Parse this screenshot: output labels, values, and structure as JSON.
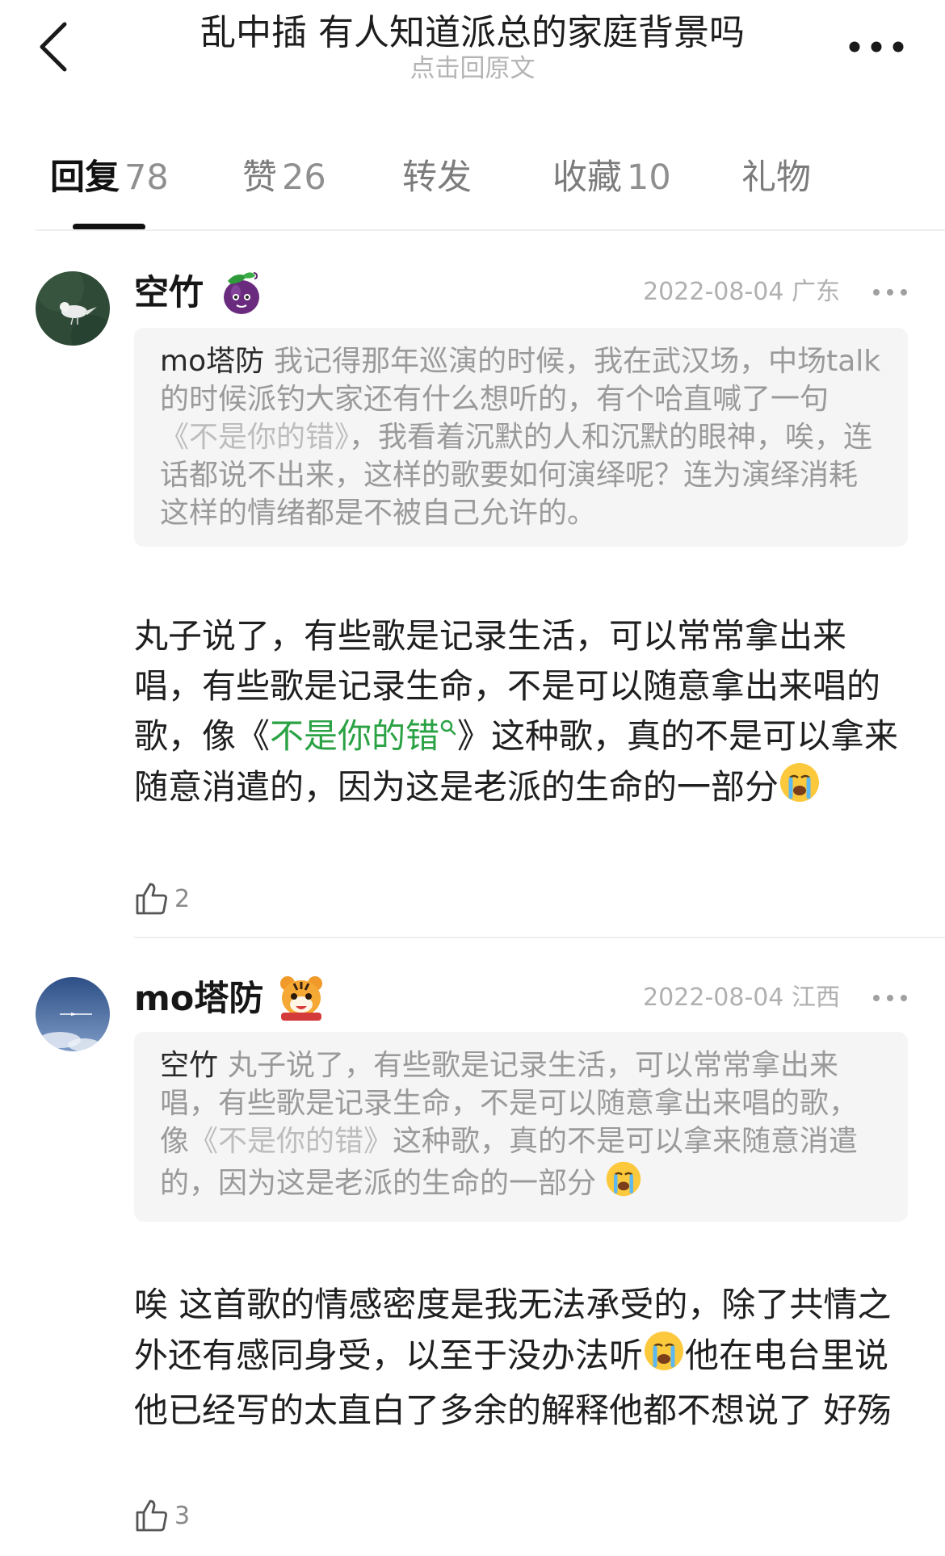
{
  "header": {
    "title": "乱中插 有人知道派总的家庭背景吗",
    "subtitle": "点击回原文"
  },
  "tabs": [
    {
      "label": "回复",
      "count": "78"
    },
    {
      "label": "赞",
      "count": "26"
    },
    {
      "label": "转发",
      "count": ""
    },
    {
      "label": "收藏",
      "count": "10"
    },
    {
      "label": "礼物",
      "count": ""
    }
  ],
  "comments": [
    {
      "username": "空竹",
      "badge_icon": "eggplant-badge-icon",
      "date": "2022-08-04",
      "location": "广东",
      "quote": {
        "author": "mo塔防",
        "text_before": "我记得那年巡演的时候，我在武汉场，中场talk的时候派钓大家还有什么想听的，有个哈直喊了一句",
        "song": "《不是你的错》",
        "text_after": "，我看着沉默的人和沉默的眼神，唉，连话都说不出来，这样的歌要如何演绎呢？连为演绎消耗这样的情绪都是不被自己允许的。"
      },
      "content": {
        "before": "丸子说了，有些歌是记录生活，可以常常拿出来唱，有些歌是记录生命，不是可以随意拿出来唱的歌，像《",
        "song": "不是你的错",
        "after": "》这种歌，真的不是可以拿来随意消遣的，因为这是老派的生命的一部分",
        "emoji": "crying-face"
      },
      "likes": "2"
    },
    {
      "username": "mo塔防",
      "badge_icon": "tiger-badge-icon",
      "date": "2022-08-04",
      "location": "江西",
      "quote": {
        "author": "空竹",
        "text_before": "丸子说了，有些歌是记录生活，可以常常拿出来唱，有些歌是记录生命，不是可以随意拿出来唱的歌，像",
        "song": "《不是你的错》",
        "text_after": "这种歌，真的不是可以拿来随意消遣的，因为这是老派的生命的一部分",
        "emoji": "crying-face"
      },
      "content": {
        "part1": "唉 这首歌的情感密度是我无法承受的，除了共情之外还有感同身受，以至于没办法听",
        "part2": "他在电台里说他已经写的太直白了多余的解释他都不想说了 好殇",
        "emoji": "crying-face"
      },
      "likes": "3"
    }
  ]
}
